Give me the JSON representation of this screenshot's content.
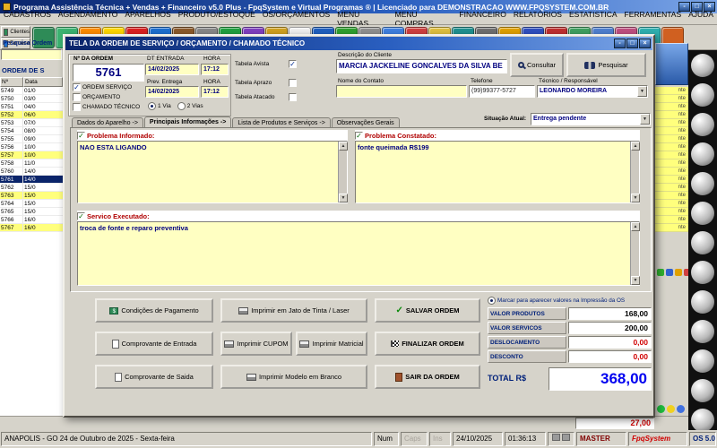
{
  "glyphs": {
    "min": "-",
    "max": "□",
    "close": "×",
    "arrow_down": "▼",
    "arrow_up": "▲",
    "check": "✓"
  },
  "titlebar": {
    "title": "Programa Assistência Técnica + Vendas + Financeiro v5.0 Plus - FpqSystem e Virtual Programas ® | Licenciado para DEMONSTRACAO WWW.FPQSYSTEM.COM.BR"
  },
  "menubar": {
    "items": [
      "CADASTROS",
      "AGENDAMENTO",
      "APARELHOS",
      "PRODUTO/ESTOQUE",
      "OS/ORÇAMENTOS",
      "MENU VENDAS",
      "MENU COMPRAS",
      "FINANCEIRO",
      "RELATÓRIOS",
      "ESTATISTICA",
      "FERRAMENTAS",
      "AJUDA"
    ]
  },
  "toolbar": {
    "tabs": [
      {
        "label": "Clientes"
      },
      {
        "label": "Fornece"
      }
    ],
    "icon_colors": [
      "#2e8b57",
      "#3cb371",
      "#ff8c00",
      "#ffd700",
      "#dc2020",
      "#1e6fd0",
      "#8b5a2b",
      "#888888",
      "#20a040",
      "#8040c0",
      "#d0a020",
      "#f0f0f0",
      "#2060c0",
      "#30a030",
      "#909090",
      "#4080e0",
      "#d04040",
      "#e0c040",
      "#209090",
      "#707070",
      "#e0a000",
      "#3050c0",
      "#c03030",
      "#40a060",
      "#5080d0",
      "#c05080",
      "#30b0b0",
      "#d06020"
    ]
  },
  "background": {
    "search_label": "Pesquisa Ordem",
    "panel_title": "ORDEM DE S",
    "grid": {
      "columns": [
        "Nº",
        "Data"
      ],
      "rows": [
        {
          "num": "5749",
          "date": "01/0",
          "status": "nte",
          "state": ""
        },
        {
          "num": "5750",
          "date": "03/0",
          "status": "nte",
          "state": ""
        },
        {
          "num": "5751",
          "date": "04/0",
          "status": "nte",
          "state": ""
        },
        {
          "num": "5752",
          "date": "06/0",
          "status": "nte",
          "state": "hl"
        },
        {
          "num": "5753",
          "date": "07/0",
          "status": "nte",
          "state": ""
        },
        {
          "num": "5754",
          "date": "08/0",
          "status": "nte",
          "state": ""
        },
        {
          "num": "5755",
          "date": "09/0",
          "status": "nte",
          "state": ""
        },
        {
          "num": "5756",
          "date": "10/0",
          "status": "nte",
          "state": ""
        },
        {
          "num": "5757",
          "date": "10/0",
          "status": "nte",
          "state": "hl"
        },
        {
          "num": "5758",
          "date": "11/0",
          "status": "nte",
          "state": ""
        },
        {
          "num": "5760",
          "date": "14/0",
          "status": "nte",
          "state": ""
        },
        {
          "num": "5761",
          "date": "14/0",
          "status": "nte",
          "state": "sel"
        },
        {
          "num": "5762",
          "date": "15/0",
          "status": "nte",
          "state": ""
        },
        {
          "num": "5763",
          "date": "15/0",
          "status": "nte",
          "state": "hl"
        },
        {
          "num": "5764",
          "date": "15/0",
          "status": "nte",
          "state": ""
        },
        {
          "num": "5765",
          "date": "15/0",
          "status": "nte",
          "state": ""
        },
        {
          "num": "5766",
          "date": "16/0",
          "status": "nte",
          "state": ""
        },
        {
          "num": "5767",
          "date": "16/0",
          "status": "nte",
          "state": "hl"
        }
      ]
    },
    "bottom_total": "27,00"
  },
  "dialog": {
    "title": "TELA DA ORDEM DE SERVIÇO / ORÇAMENTO / CHAMADO TÉCNICO",
    "order": {
      "num_label": "Nº DA ORDEM",
      "num_value": "5761",
      "dt_label": "DT ENTRADA",
      "hora_label": "HORA",
      "dt_value": "14/02/2025",
      "hora_value": "17:12",
      "prev_label": "Prev. Entrega",
      "prev_hora_label": "HORA",
      "prev_value": "14/02/2025",
      "prev_hora_value": "17:12",
      "check_os": "ORDEM SERVIÇO",
      "check_orc": "ORÇAMENTO",
      "check_ct": "CHAMADO TÉCNICO",
      "via1": "1 Via",
      "via2": "2 Vias"
    },
    "tabelas": {
      "avista": "Tabela Avista",
      "aprazo": "Tabela Aprazo",
      "atacado": "Tabela Atacado"
    },
    "client": {
      "desc_label": "Descrição do Cliente",
      "desc_value": "MARCIA JACKELINE GONCALVES DA SILVA BE",
      "contato_label": "Nome do Contato",
      "contato_value": "",
      "tel_label": "Telefone",
      "tel_value": "(99)99377-5727",
      "tec_label": "Técnico / Responsável",
      "tec_value": "LEONARDO MOREIRA",
      "consultar": "Consultar",
      "pesquisar": "Pesquisar"
    },
    "tabs": [
      "Dados do Aparelho ->",
      "Principais Informações ->",
      "Lista de Produtos e Serviços ->",
      "Observações Gerais"
    ],
    "situacao": {
      "label": "Situação Atual:",
      "value": "Entrega pendente"
    },
    "fields": {
      "pi_label": "Problema Informado:",
      "pi_text": "NAO ESTA LIGANDO",
      "pc_label": "Problema Constatado:",
      "pc_text": "fonte queimada R$199",
      "se_label": "Servico Executado:",
      "se_text": "troca de fonte e reparo preventiva"
    },
    "buttons": {
      "condicoes": "Condições de Pagamento",
      "imprimir_jato": "Imprimir em Jato de Tinta / Laser",
      "salvar": "SALVAR ORDEM",
      "comprovante_entrada": "Comprovante de Entrada",
      "imprimir_cupom": "Imprimir CUPOM",
      "imprimir_matricial": "Imprimir Matricial",
      "finalizar": "FINALIZAR ORDEM",
      "comprovante_saida": "Comprovante de Saida",
      "imprimir_branco": "Imprimir Modelo em Branco",
      "sair": "SAIR DA ORDEM"
    },
    "totals": {
      "marcar": "Marcar para aparecer valores na Impressão da OS",
      "rows": [
        {
          "label": "VALOR PRODUTOS",
          "value": "168,00",
          "color": "black"
        },
        {
          "label": "VALOR SERVICOS",
          "value": "200,00",
          "color": "black"
        },
        {
          "label": "DESLOCAMENTO",
          "value": "0,00",
          "color": "red"
        },
        {
          "label": "DESCONTO",
          "value": "0,00",
          "color": "red"
        }
      ],
      "total_label": "TOTAL R$",
      "total_value": "368,00"
    }
  },
  "statusbar": {
    "location": "ANAPOLIS - GO 24 de Outubro de 2025 - Sexta-feira",
    "num": "Num",
    "caps": "Caps",
    "ins": "Ins",
    "date": "24/10/2025",
    "time": "01:36:13",
    "user": "MASTER",
    "brand": "FpqSystem",
    "version": "OS 5.0"
  }
}
